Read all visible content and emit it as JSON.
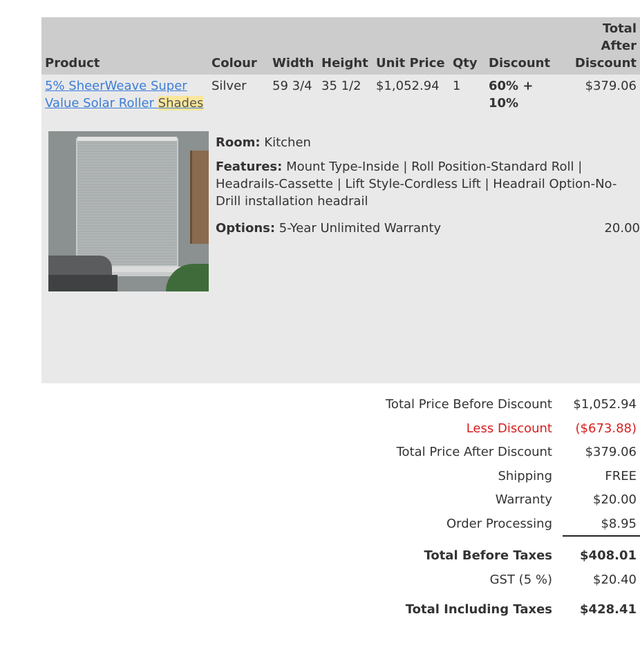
{
  "table": {
    "headers": {
      "product": "Product",
      "colour": "Colour",
      "width": "Width",
      "height": "Height",
      "unit_price": "Unit Price",
      "qty": "Qty",
      "discount": "Discount",
      "total_after_discount": "Total After Discount"
    },
    "row": {
      "product_link_part1": "5% SheerWeave Super Value Solar Roller",
      "product_link_part2": "Shades",
      "colour": "Silver",
      "width": "59 3/4",
      "height": "35 1/2",
      "unit_price": "$1,052.94",
      "qty": "1",
      "discount": "60% + 10%",
      "total": "$379.06"
    },
    "details": {
      "room_label": "Room:",
      "room_value": "Kitchen",
      "features_label": "Features:",
      "features_value": "Mount Type-Inside | Roll Position-Standard Roll | Headrails-Cassette | Lift Style-Cordless Lift | Headrail Option-No-Drill installation headrail",
      "options_label": "Options:",
      "options_value": "5-Year Unlimited Warranty",
      "options_price": "20.00"
    }
  },
  "totals": [
    {
      "label": "Total Price Before Discount",
      "value": "$1,052.94"
    },
    {
      "label": "Less Discount",
      "value": "($673.88)"
    },
    {
      "label": "Total Price After Discount",
      "value": "$379.06"
    },
    {
      "label": "Shipping",
      "value": "FREE"
    },
    {
      "label": "Warranty",
      "value": "$20.00"
    },
    {
      "label": "Order Processing",
      "value": "$8.95"
    },
    {
      "label": "Total Before Taxes",
      "value": "$408.01"
    },
    {
      "label": "GST (5 %)",
      "value": "$20.40"
    },
    {
      "label": "Total Including Taxes",
      "value": "$428.41"
    }
  ],
  "colors": {
    "header_bg": "#cccccc",
    "row_bg": "#e9e9e9",
    "link": "#3b7dd8",
    "discount_red": "#d81e1e",
    "highlight": "#fbe79b"
  },
  "icons": {
    "product_thumbnail": "roller-shade-photo"
  }
}
